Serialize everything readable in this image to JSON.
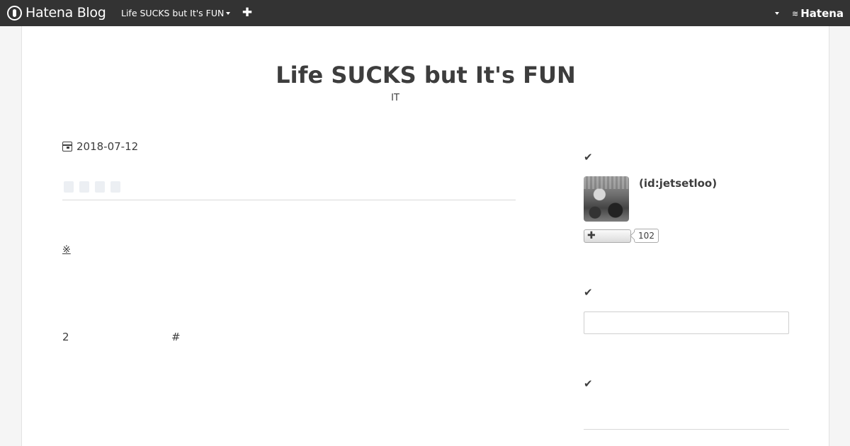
{
  "topbar": {
    "brand": "Hatena Blog",
    "blog_switcher": "Life SUCKS but It's FUN",
    "add_label": "✚",
    "hatena_label": "Hatena"
  },
  "blog": {
    "title": "Life SUCKS but It's FUN",
    "description": "IT"
  },
  "article": {
    "date": "2018-07-12",
    "note_mark": "※",
    "body_number": "2",
    "body_hash": "#"
  },
  "sidebar": {
    "profile": {
      "id_label": "(id:jetsetloo)",
      "follow_label": "✚",
      "follower_count": "102"
    },
    "search": {
      "value": ""
    }
  }
}
